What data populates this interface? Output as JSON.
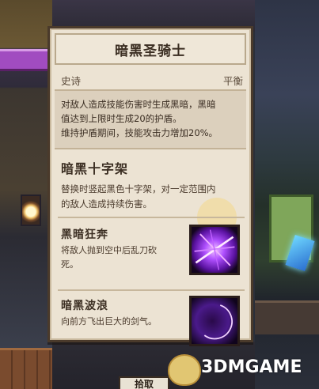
{
  "tooltip": {
    "title": "暗黑圣骑士",
    "rarity": "史诗",
    "type": "平衡",
    "description": [
      "对敌人造成技能伤害时生成黑暗，黑暗",
      "值达到上限时生成20的护盾。",
      "维持护盾期间，技能攻击力增加20%。"
    ],
    "main_skill": {
      "name": "暗黑十字架",
      "description": [
        "替换时竖起黑色十字架，对一定范围内",
        "的敌人造成持续伤害。"
      ]
    },
    "skills": [
      {
        "name": "黑暗狂奔",
        "description": [
          "将敌人抛到空中后乱刀砍",
          "死。"
        ],
        "icon": "dark-slash-icon"
      },
      {
        "name": "暗黑波浪",
        "description": [
          "向前方飞出巨大的剑气。"
        ],
        "icon": "dark-wave-icon"
      }
    ]
  },
  "watermark": {
    "text": "3DMGAME",
    "icon": "mascot-icon"
  },
  "bottom_button": {
    "label": "拾取"
  },
  "colors": {
    "panel_bg": "#ece3d3",
    "panel_border": "#4a3a2b",
    "desc_bg": "#dcd0bd",
    "text_dark": "#3b2e22",
    "skill_icon_purple": "#9b3cf0"
  }
}
